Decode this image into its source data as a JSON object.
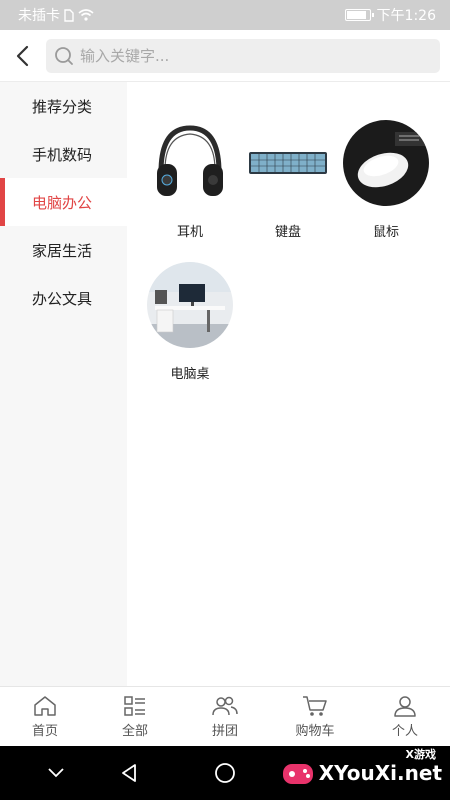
{
  "status_bar": {
    "carrier": "未插卡",
    "time": "下午1:26",
    "battery_level": 0.8
  },
  "header": {
    "back_icon": "chevron-left-icon",
    "search_placeholder": "输入关键字..."
  },
  "sidebar": {
    "items": [
      {
        "label": "推荐分类",
        "active": false
      },
      {
        "label": "手机数码",
        "active": false
      },
      {
        "label": "电脑办公",
        "active": true
      },
      {
        "label": "家居生活",
        "active": false
      },
      {
        "label": "办公文具",
        "active": false
      }
    ]
  },
  "content": {
    "items": [
      {
        "label": "耳机",
        "icon": "headphones-image"
      },
      {
        "label": "键盘",
        "icon": "keyboard-image"
      },
      {
        "label": "鼠标",
        "icon": "mouse-image"
      },
      {
        "label": "电脑桌",
        "icon": "computer-desk-image"
      }
    ]
  },
  "tabbar": {
    "tabs": [
      {
        "label": "首页",
        "icon": "home-icon"
      },
      {
        "label": "全部",
        "icon": "list-icon"
      },
      {
        "label": "拼团",
        "icon": "group-icon"
      },
      {
        "label": "购物车",
        "icon": "cart-icon"
      },
      {
        "label": "个人",
        "icon": "user-icon"
      }
    ]
  },
  "watermark": {
    "text": "XYouXi.net",
    "small_text": "X游戏"
  },
  "colors": {
    "accent": "#e14545",
    "status_bar_bg": "#cfcfcf",
    "sidebar_bg": "#f7f7f7",
    "nav_bar_bg": "#000000"
  }
}
